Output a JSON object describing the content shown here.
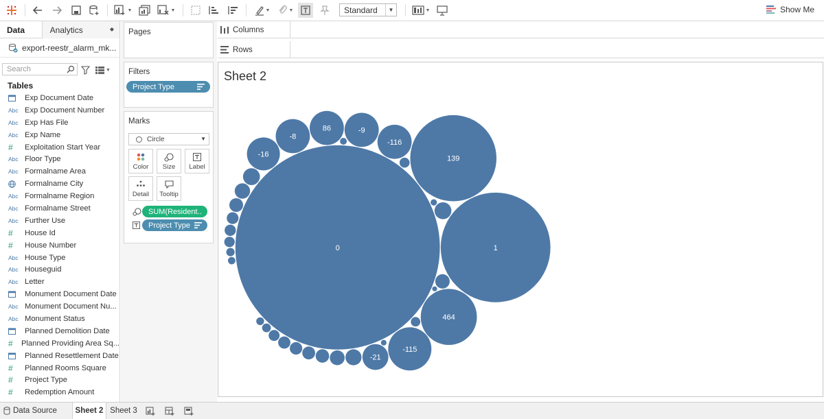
{
  "toolbar": {
    "view_mode": "Standard",
    "show_me": "Show Me"
  },
  "data_pane": {
    "tab_data": "Data",
    "tab_analytics": "Analytics",
    "datasource": "export-reestr_alarm_mk...",
    "search_placeholder": "Search",
    "tables_heading": "Tables",
    "fields": [
      {
        "type": "date",
        "name": "Exp Document Date"
      },
      {
        "type": "abc",
        "name": "Exp Document Number"
      },
      {
        "type": "abc",
        "name": "Exp Has File"
      },
      {
        "type": "abc",
        "name": "Exp Name"
      },
      {
        "type": "num",
        "name": "Exploitation Start Year"
      },
      {
        "type": "abc",
        "name": "Floor Type"
      },
      {
        "type": "abc",
        "name": "Formalname Area"
      },
      {
        "type": "geo",
        "name": "Formalname City"
      },
      {
        "type": "abc",
        "name": "Formalname Region"
      },
      {
        "type": "abc",
        "name": "Formalname Street"
      },
      {
        "type": "abc",
        "name": "Further Use"
      },
      {
        "type": "num",
        "name": "House Id"
      },
      {
        "type": "num",
        "name": "House Number"
      },
      {
        "type": "abc",
        "name": "House Type"
      },
      {
        "type": "abc",
        "name": "Houseguid"
      },
      {
        "type": "abc",
        "name": "Letter"
      },
      {
        "type": "date",
        "name": "Monument Document Date"
      },
      {
        "type": "abc",
        "name": "Monument Document Nu..."
      },
      {
        "type": "abc",
        "name": "Monument Status"
      },
      {
        "type": "date",
        "name": "Planned Demolition Date"
      },
      {
        "type": "num",
        "name": "Planned Providing Area Sq..."
      },
      {
        "type": "date",
        "name": "Planned Resettlement Date"
      },
      {
        "type": "num",
        "name": "Planned Rooms Square"
      },
      {
        "type": "num",
        "name": "Project Type"
      },
      {
        "type": "num",
        "name": "Redemption Amount"
      }
    ]
  },
  "shelves": {
    "pages": "Pages",
    "filters": "Filters",
    "filter_pill": "Project Type",
    "marks": "Marks",
    "mark_type": "Circle",
    "mark_buttons": [
      "Color",
      "Size",
      "Label",
      "Detail",
      "Tooltip"
    ],
    "size_pill": "SUM(Resident..",
    "label_pill": "Project Type",
    "columns": "Columns",
    "rows": "Rows"
  },
  "sheet": {
    "title": "Sheet 2"
  },
  "chart_data": {
    "type": "packed-bubble",
    "mark_color": "#4e79a7",
    "size_measure": "SUM(Resident..",
    "label_dimension": "Project Type",
    "labeled_bubbles": [
      {
        "label": "0",
        "relative_size": 1.0
      },
      {
        "label": "1",
        "relative_size": 0.29
      },
      {
        "label": "139",
        "relative_size": 0.18
      },
      {
        "label": "464",
        "relative_size": 0.077
      },
      {
        "label": "-115",
        "relative_size": 0.046
      },
      {
        "label": "-116",
        "relative_size": 0.029
      },
      {
        "label": "-9",
        "relative_size": 0.029
      },
      {
        "label": "86",
        "relative_size": 0.029
      },
      {
        "label": "-8",
        "relative_size": 0.029
      },
      {
        "label": "-16",
        "relative_size": 0.027
      },
      {
        "label": "-21",
        "relative_size": 0.017
      }
    ],
    "unlabeled_bubble_count": 25
  },
  "bottom_tabs": {
    "data_source": "Data Source",
    "sheets": [
      "Sheet 2",
      "Sheet 3"
    ],
    "active_sheet": "Sheet 2"
  }
}
